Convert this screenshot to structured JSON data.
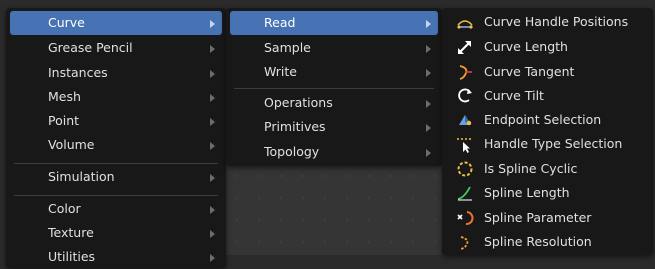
{
  "menu1": {
    "items": [
      {
        "label": "Curve",
        "active": true
      },
      {
        "label": "Grease Pencil"
      },
      {
        "label": "Instances"
      },
      {
        "label": "Mesh"
      },
      {
        "label": "Point"
      },
      {
        "label": "Volume"
      },
      {
        "label": "Simulation"
      },
      {
        "label": "Color"
      },
      {
        "label": "Texture"
      },
      {
        "label": "Utilities"
      }
    ]
  },
  "menu2": {
    "items": [
      {
        "label": "Read",
        "active": true
      },
      {
        "label": "Sample"
      },
      {
        "label": "Write"
      },
      {
        "label": "Operations"
      },
      {
        "label": "Primitives"
      },
      {
        "label": "Topology"
      }
    ]
  },
  "menu3": {
    "items": [
      {
        "label": "Curve Handle Positions",
        "icon": "curve-handle-positions-icon"
      },
      {
        "label": "Curve Length",
        "icon": "curve-length-icon"
      },
      {
        "label": "Curve Tangent",
        "icon": "curve-tangent-icon"
      },
      {
        "label": "Curve Tilt",
        "icon": "curve-tilt-icon"
      },
      {
        "label": "Endpoint Selection",
        "icon": "endpoint-selection-icon"
      },
      {
        "label": "Handle Type Selection",
        "icon": "handle-type-selection-icon"
      },
      {
        "label": "Is Spline Cyclic",
        "icon": "spline-cyclic-icon"
      },
      {
        "label": "Spline Length",
        "icon": "spline-length-icon"
      },
      {
        "label": "Spline Parameter",
        "icon": "spline-parameter-icon"
      },
      {
        "label": "Spline Resolution",
        "icon": "spline-resolution-icon"
      }
    ]
  },
  "colors": {
    "menu_bg": "#181818",
    "highlight": "#4772b3",
    "text": "#e0e0e0",
    "separator": "#3c3c3c"
  }
}
